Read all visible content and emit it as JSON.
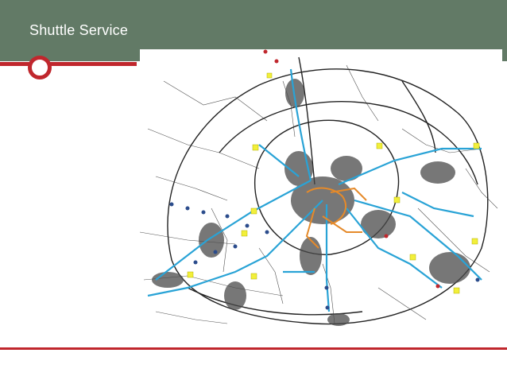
{
  "header": {
    "title": "Shuttle Service"
  },
  "colors": {
    "header_bg": "#627a66",
    "accent": "#c0272d",
    "road": "#222222",
    "shuttle_route": "#29a3d6",
    "central_route": "#e58a2a",
    "stop_marker": "#f2ef3a",
    "node_marker": "#2b4c8c"
  },
  "map": {
    "legend_icons": [
      "yellow-stop-marker",
      "blue-node-marker",
      "red-node-marker"
    ]
  }
}
